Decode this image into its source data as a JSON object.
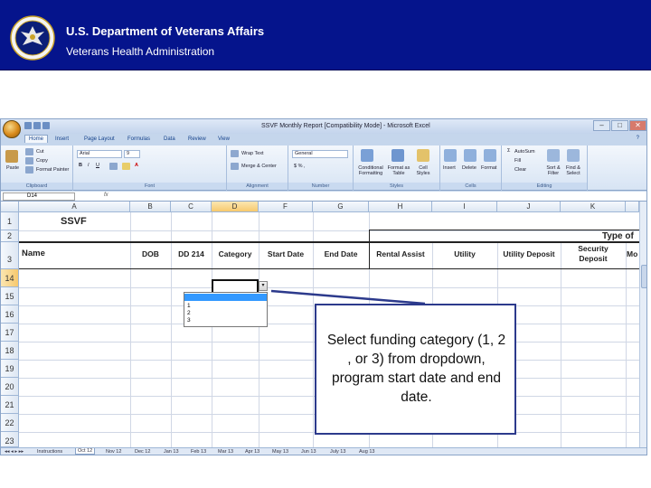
{
  "banner": {
    "department": "U.S. Department of Veterans Affairs",
    "administration": "Veterans Health Administration",
    "bg_color": "#05148c"
  },
  "excel": {
    "window_title": "SSVF Monthly Report [Compatibility Mode] - Microsoft Excel",
    "ribbon_tabs": [
      "Home",
      "Insert",
      "Page Layout",
      "Formulas",
      "Data",
      "Review",
      "View"
    ],
    "active_tab": "Home",
    "ribbon": {
      "clipboard": {
        "paste": "Paste",
        "cut": "Cut",
        "copy": "Copy",
        "format_painter": "Format Painter",
        "label": "Clipboard"
      },
      "font": {
        "name": "Arial",
        "size": "9",
        "label": "Font"
      },
      "alignment": {
        "wrap_text": "Wrap Text",
        "merge_center": "Merge & Center",
        "label": "Alignment"
      },
      "number": {
        "format": "General",
        "label": "Number"
      },
      "styles": {
        "conditional": "Conditional Formatting",
        "format_table": "Format as Table",
        "cell_styles": "Cell Styles",
        "label": "Styles"
      },
      "cells": {
        "insert": "Insert",
        "delete": "Delete",
        "format": "Format",
        "label": "Cells"
      },
      "editing": {
        "autosum": "AutoSum",
        "fill": "Fill",
        "clear": "Clear",
        "sort_filter": "Sort & Filter",
        "find_select": "Find & Select",
        "label": "Editing"
      }
    },
    "name_box": "D14",
    "fx": "fx",
    "columns": [
      "A",
      "B",
      "C",
      "D",
      "F",
      "G",
      "H",
      "I",
      "J",
      "K"
    ],
    "selected_column": "D",
    "rows": [
      "1",
      "2",
      "3",
      "14",
      "15",
      "16",
      "17",
      "18",
      "19",
      "20",
      "21",
      "22",
      "23"
    ],
    "selected_row": "14",
    "sheet_title": "SSVF",
    "type_of_label": "Type of",
    "headers": {
      "name": "Name",
      "dob": "DOB",
      "dd214": "DD 214",
      "category": "Category",
      "start_date": "Start Date",
      "end_date": "End Date",
      "rental_assist": "Rental Assist",
      "utility": "Utility",
      "utility_deposit": "Utility Deposit",
      "security_deposit_1": "Security",
      "security_deposit_2": "Deposit",
      "more": "Mo"
    },
    "dropdown_options": [
      "",
      "1",
      "2",
      "3"
    ],
    "sheet_tabs": [
      "Instructions",
      "Oct 12",
      "Nov 12",
      "Dec 12",
      "Jan 13",
      "Feb 13",
      "Mar 13",
      "Apr 13",
      "May 13",
      "Jun 13",
      "July 13",
      "Aug 13"
    ],
    "active_sheet": "Oct 12"
  },
  "callout": {
    "text": "Select funding category (1, 2 , or 3) from dropdown, program start date and end date.",
    "border_color": "#2c3a8c"
  }
}
